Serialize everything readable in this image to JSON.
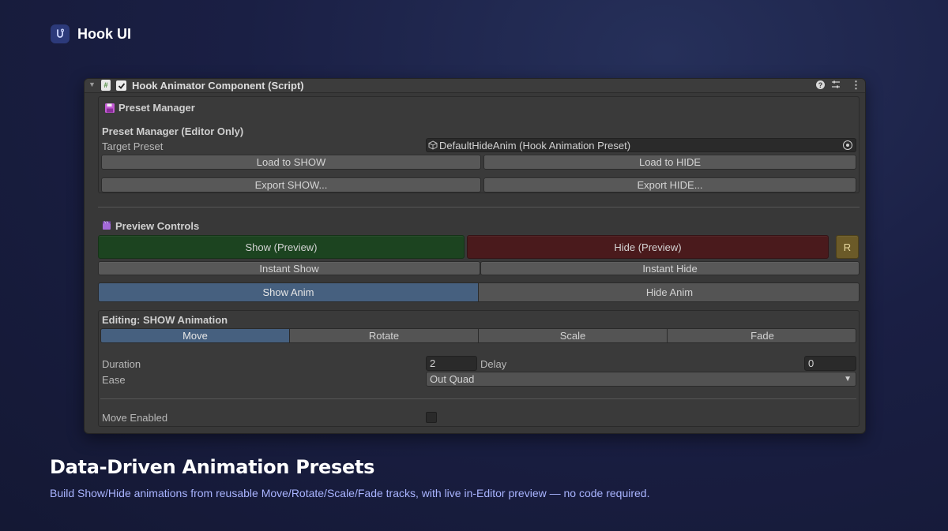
{
  "brand": {
    "name": "Hook UI"
  },
  "component": {
    "title": "Hook Animator Component (Script)"
  },
  "preset_manager": {
    "section_title": "Preset Manager",
    "subheading": "Preset Manager (Editor Only)",
    "target_label": "Target Preset",
    "target_value": "DefaultHideAnim (Hook Animation Preset)",
    "load_show": "Load to SHOW",
    "load_hide": "Load to HIDE",
    "export_show": "Export SHOW...",
    "export_hide": "Export HIDE..."
  },
  "preview_controls": {
    "section_title": "Preview Controls",
    "show_preview": "Show (Preview)",
    "hide_preview": "Hide (Preview)",
    "reset": "R",
    "instant_show": "Instant Show",
    "instant_hide": "Instant Hide",
    "anim_tabs": [
      "Show Anim",
      "Hide Anim"
    ],
    "active_anim_tab": "Show Anim"
  },
  "editing": {
    "heading": "Editing: SHOW Animation",
    "tabs": [
      "Move",
      "Rotate",
      "Scale",
      "Fade"
    ],
    "active_tab": "Move",
    "duration_label": "Duration",
    "duration_value": "2",
    "delay_label": "Delay",
    "delay_value": "0",
    "ease_label": "Ease",
    "ease_value": "Out Quad",
    "move_enabled_label": "Move Enabled",
    "move_enabled": false
  },
  "colors": {
    "show_preview_bg": "#1c4420",
    "hide_preview_bg": "#4a1a1c",
    "reset_bg": "#6b5a28",
    "active_tab_bg": "#46607f"
  },
  "hero": {
    "title": "Data-Driven Animation Presets",
    "subtitle": "Build Show/Hide animations from reusable Move/Rotate/Scale/Fade tracks, with live in-Editor preview — no code required."
  }
}
